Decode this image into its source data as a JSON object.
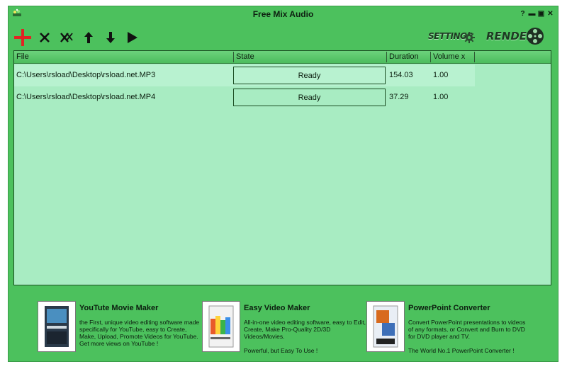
{
  "window": {
    "title": "Free Mix Audio"
  },
  "title_controls": [
    {
      "name": "help-icon",
      "glyph": "?"
    },
    {
      "name": "minimize-icon",
      "glyph": "▬"
    },
    {
      "name": "maximize-icon",
      "glyph": "▣"
    },
    {
      "name": "close-icon",
      "glyph": "✕"
    }
  ],
  "toolbar": {
    "buttons": [
      {
        "name": "add-file-button",
        "icon": "plus-icon",
        "color": "#e22424"
      },
      {
        "name": "remove-file-button",
        "icon": "x-icon"
      },
      {
        "name": "remove-all-button",
        "icon": "double-x-icon"
      },
      {
        "name": "move-up-button",
        "icon": "arrow-up-icon"
      },
      {
        "name": "move-down-button",
        "icon": "arrow-down-icon"
      },
      {
        "name": "play-button",
        "icon": "play-icon"
      }
    ],
    "settings_label": "SETTINGS",
    "render_label": "RENDER"
  },
  "file_list": {
    "columns": [
      "File",
      "State",
      "Duration",
      "Volume x"
    ],
    "rows": [
      {
        "file": "C:\\Users\\rsload\\Desktop\\rsload.net.MP3",
        "state": "Ready",
        "duration": "154.03",
        "volume": "1.00"
      },
      {
        "file": "C:\\Users\\rsload\\Desktop\\rsload.net.MP4",
        "state": "Ready",
        "duration": "37.29",
        "volume": "1.00"
      }
    ]
  },
  "promos": [
    {
      "title": "YouTute Movie Maker",
      "description": "the First, unique video editing software made specifically for YouTube, easy to Create, Make, Upload, Promote Videos for YouTube.\nGet more views on YouTube !",
      "thumb_colors": [
        "#2a3a4a",
        "#4a8fc0"
      ]
    },
    {
      "title": "Easy Video Maker",
      "description": "All-in-one video editing software, easy to Edit, Create, Make Pro-Quality 2D/3D Videos/Movies.\n\nPowerful, but Easy To Use !",
      "thumb_colors": [
        "#e85a2a",
        "#ffd23a"
      ]
    },
    {
      "title": "PowerPoint Converter",
      "description": "Convert PowerPoint presentations to videos of any formats, or Convert and Burn to DVD for DVD player and TV.\n\nThe World No.1 PowerPoint Converter !",
      "thumb_colors": [
        "#d86a1e",
        "#3e6fb8"
      ]
    }
  ],
  "colors": {
    "window_bg": "#4cc15d",
    "list_bg": "#a8ecc2",
    "row_selected": "#b8f2d0"
  }
}
